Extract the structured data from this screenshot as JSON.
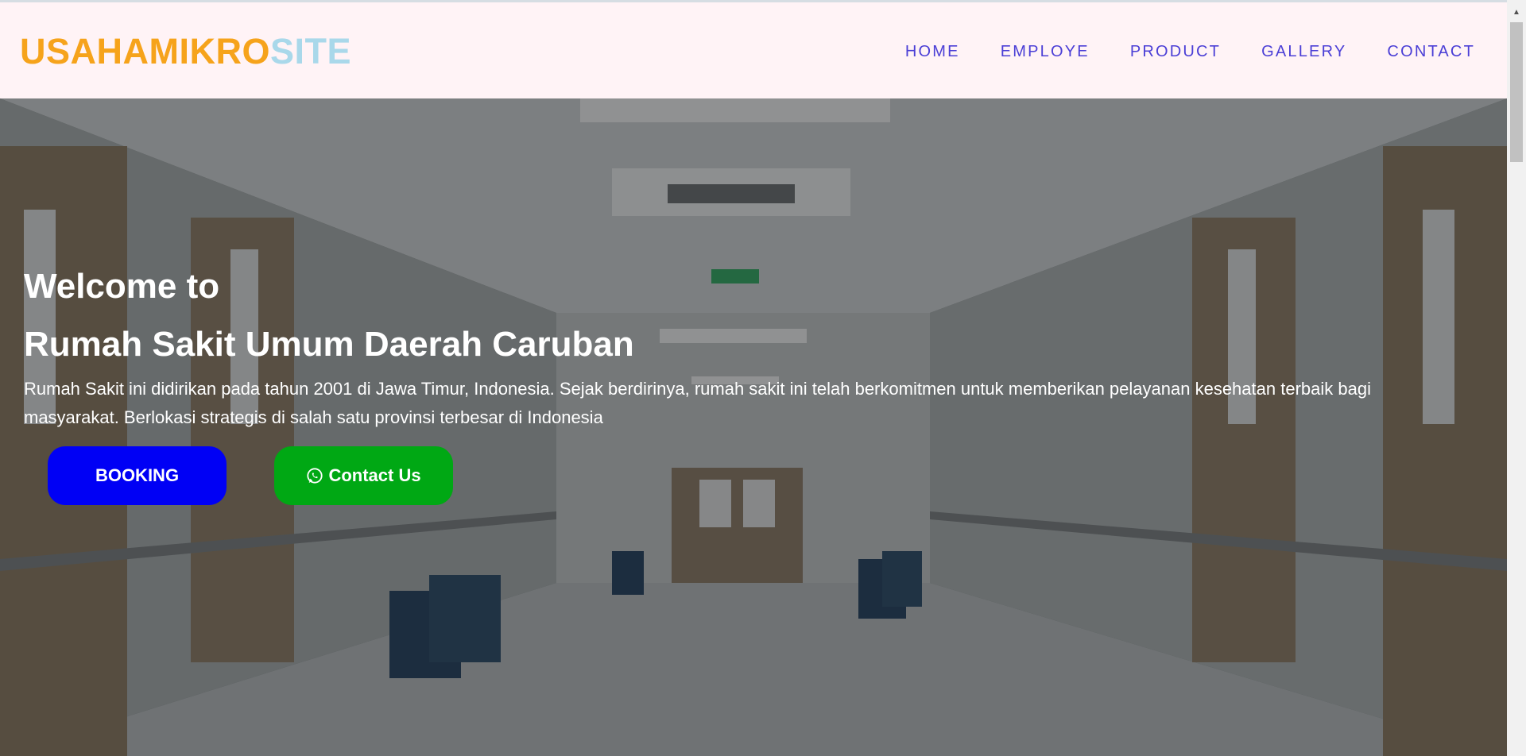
{
  "logo": {
    "part1": "USAHAMIKRO",
    "part2": "SITE"
  },
  "nav": {
    "items": [
      {
        "label": "HOME"
      },
      {
        "label": "EMPLOYE"
      },
      {
        "label": "PRODUCT"
      },
      {
        "label": "GALLERY"
      },
      {
        "label": "CONTACT"
      }
    ]
  },
  "hero": {
    "title_line1": "Welcome to",
    "title_line2": "Rumah Sakit Umum Daerah Caruban",
    "description": "Rumah Sakit ini didirikan pada tahun 2001 di Jawa Timur, Indonesia. Sejak berdirinya, rumah sakit ini telah berkomitmen untuk memberikan pelayanan kesehatan terbaik bagi masyarakat. Berlokasi strategis di salah satu provinsi terbesar di Indonesia",
    "background_image": "hospital-corridor-image",
    "buttons": {
      "booking_label": "BOOKING",
      "contact_label": "Contact Us",
      "contact_icon": "whatsapp-icon"
    }
  },
  "colors": {
    "logo_primary": "#f6a31b",
    "logo_secondary": "#a9d8ea",
    "nav_text": "#4b3fd6",
    "header_bg": "#fff3f6",
    "booking_button": "#0000f5",
    "contact_button": "#00a814"
  }
}
